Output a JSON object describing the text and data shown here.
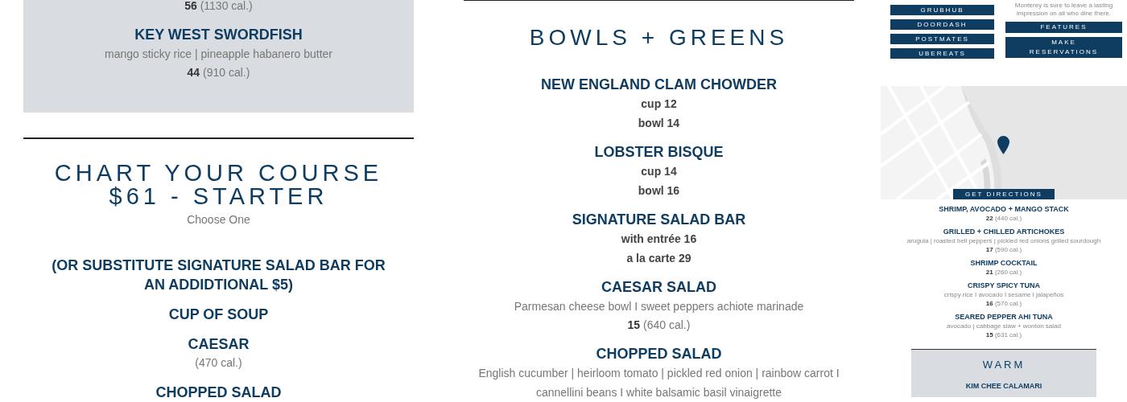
{
  "left_column": {
    "top_card": {
      "items": [
        {
          "price": "**56** (1130 cal.)"
        },
        {
          "name": "KEY WEST SWORDFISH",
          "description": "mango sticky rice | pineapple habanero butter",
          "price": "**44** (910 cal.)"
        }
      ]
    },
    "section": {
      "title": "CHART YOUR COURSE $61 - STARTER",
      "subtitle": "Choose One",
      "items": [
        {
          "name": "(OR SUBSTITUTE SIGNATURE SALAD BAR FOR AN ADDIDTIONAL $5)"
        },
        {
          "name": "CUP OF SOUP"
        },
        {
          "name": "CAESAR",
          "price": "(470 cal.)"
        },
        {
          "name": "CHOPPED SALAD"
        }
      ]
    }
  },
  "middle_column": {
    "title": "BOWLS + GREENS",
    "items": [
      {
        "name": "NEW ENGLAND CLAM CHOWDER",
        "options": [
          "cup 12",
          "bowl 14"
        ]
      },
      {
        "name": "LOBSTER BISQUE",
        "options": [
          "cup 14",
          "bowl 16"
        ]
      },
      {
        "name": "SIGNATURE SALAD BAR",
        "options": [
          "with entrée 16",
          "a la carte 29"
        ]
      },
      {
        "name": "CAESAR SALAD",
        "description": "Parmesan cheese bowl I sweet peppers achiote marinade",
        "price": "**15** (640 cal.)"
      },
      {
        "name": "CHOPPED SALAD",
        "description": "English cucumber | heirloom tomato | pickled red onion | rainbow carrot I cannellini beans I white balsamic basil vinaigrette"
      }
    ]
  },
  "right_column": {
    "order_buttons": [
      "GRUBHUB",
      "DOORDASH",
      "POSTMATES",
      "UBEREATS"
    ],
    "about_text": "Monterey is sure to leave a lasting impression on all who dine there.",
    "link_buttons": [
      "FEATURES",
      "MAKE RESERVATIONS"
    ],
    "map": {
      "kind": "picture",
      "button": "GET DIRECTIONS"
    },
    "menu_items": [
      {
        "name": "SHRIMP, AVOCADO + MANGO STACK",
        "price": "**22** (440 cal.)"
      },
      {
        "name": "GRILLED + CHILLED ARTICHOKES",
        "description": "arugula | roasted bell peppers | pickled red onions grilled sourdough",
        "price": "**17** (590 cal.)"
      },
      {
        "name": "SHRIMP COCKTAIL",
        "price": "**21** (260 cal.)"
      },
      {
        "name": "CRISPY SPICY TUNA",
        "description": "crispy rice I avocado I sesame I jalapeños",
        "price": "**16** (570 cal.)"
      },
      {
        "name": "SEARED PEPPER AHI TUNA",
        "description": "avocado | cabbage slaw + wonton salad",
        "price": "**15** (631 cal.)"
      }
    ],
    "warm_card": {
      "title": "WARM",
      "items": [
        {
          "name": "KIM CHEE CALAMARI"
        }
      ]
    }
  }
}
